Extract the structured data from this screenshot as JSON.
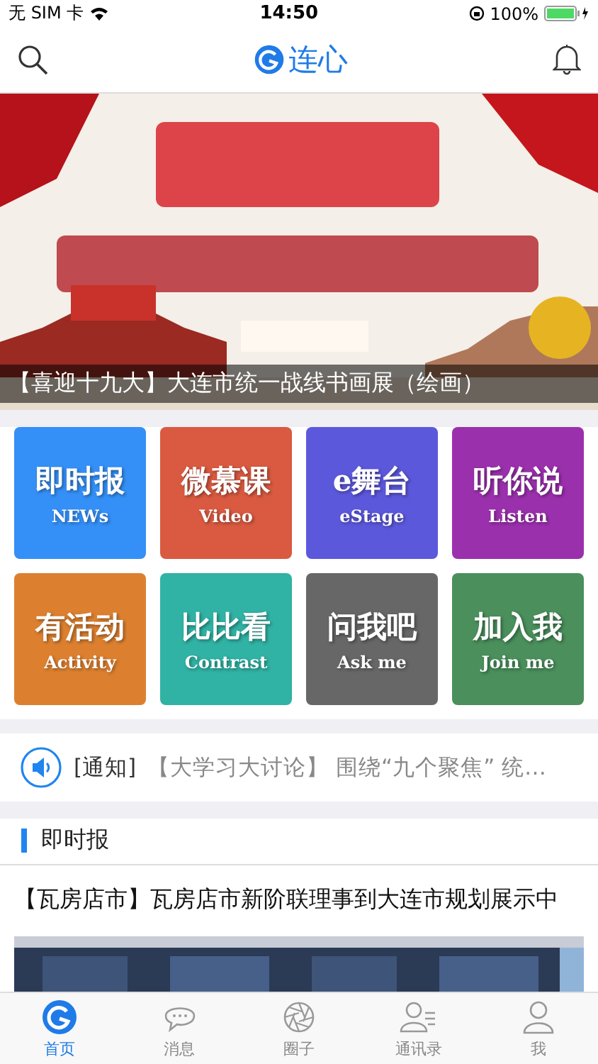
{
  "status_bar": {
    "carrier": "无 SIM 卡",
    "time": "14:50",
    "battery": "100%"
  },
  "nav": {
    "title": "连心"
  },
  "banner": {
    "kind": "picture",
    "caption": "【喜迎十九大】大连市统一战线书画展（绘画）"
  },
  "tiles": [
    {
      "title": "即时报",
      "subtitle": "NEWs",
      "color": "#3490f7"
    },
    {
      "title": "微慕课",
      "subtitle": "Video",
      "color": "#d95a40"
    },
    {
      "title": "e舞台",
      "subtitle": "eStage",
      "color": "#5c58dc"
    },
    {
      "title": "听你说",
      "subtitle": "Listen",
      "color": "#9b30ad"
    },
    {
      "title": "有活动",
      "subtitle": "Activity",
      "color": "#dc8030"
    },
    {
      "title": "比比看",
      "subtitle": "Contrast",
      "color": "#30b2a4"
    },
    {
      "title": "问我吧",
      "subtitle": "Ask me",
      "color": "#676767"
    },
    {
      "title": "加入我",
      "subtitle": "Join me",
      "color": "#4a8f5c"
    }
  ],
  "notice": {
    "tag": "[通知]",
    "text": "【大学习大讨论】 围绕“九个聚焦” 统…"
  },
  "section": {
    "title": "即时报"
  },
  "news": [
    {
      "title": "【瓦房店市】瓦房店市新阶联理事到大连市规划展示中"
    }
  ],
  "tab_bar": [
    {
      "label": "首页",
      "selected": true
    },
    {
      "label": "消息",
      "selected": false
    },
    {
      "label": "圈子",
      "selected": false
    },
    {
      "label": "通讯录",
      "selected": false
    },
    {
      "label": "我",
      "selected": false
    }
  ]
}
